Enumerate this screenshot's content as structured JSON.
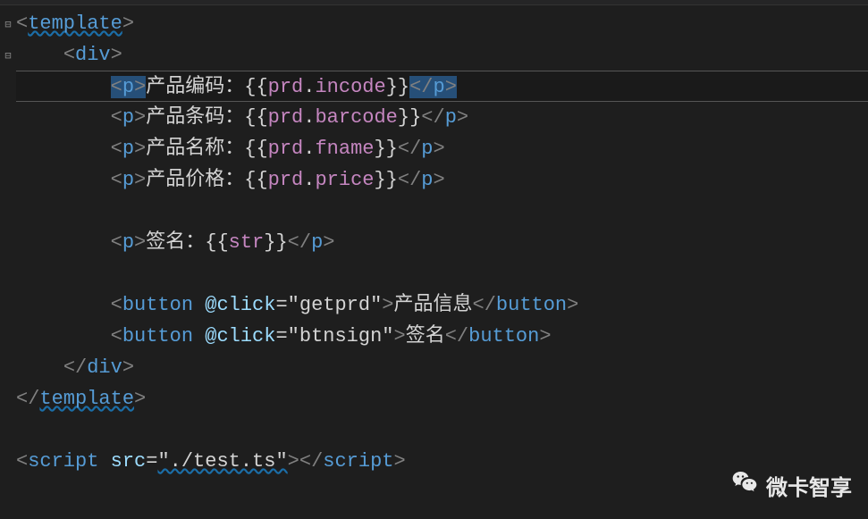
{
  "fold": [
    "⊟",
    "⊟",
    "",
    "",
    "",
    "",
    "",
    "",
    "",
    "",
    "",
    "",
    "",
    "",
    "",
    ""
  ],
  "code": {
    "l1": {
      "tag": "template"
    },
    "l2": {
      "tag": "div"
    },
    "l3": {
      "tag": "p",
      "label": "产品编码：",
      "obj": "prd",
      "prop": "incode"
    },
    "l4": {
      "tag": "p",
      "label": "产品条码：",
      "obj": "prd",
      "prop": "barcode"
    },
    "l5": {
      "tag": "p",
      "label": "产品名称：",
      "obj": "prd",
      "prop": "fname"
    },
    "l6": {
      "tag": "p",
      "label": "产品价格：",
      "obj": "prd",
      "prop": "price"
    },
    "l7": {},
    "l8": {
      "tag": "p",
      "label": "签名：",
      "obj": "str"
    },
    "l9": {},
    "l10": {
      "tag": "button",
      "dir": "@click",
      "val": "\"getprd\"",
      "text": "产品信息"
    },
    "l11": {
      "tag": "button",
      "dir": "@click",
      "val": "\"btnsign\"",
      "text": "签名"
    },
    "l12": {
      "tag": "div"
    },
    "l13": {
      "tag": "template"
    },
    "l14": {},
    "l15": {
      "tag": "script",
      "dir": "src",
      "val": "\"./test.ts\""
    }
  },
  "watermark": "微卡智享"
}
